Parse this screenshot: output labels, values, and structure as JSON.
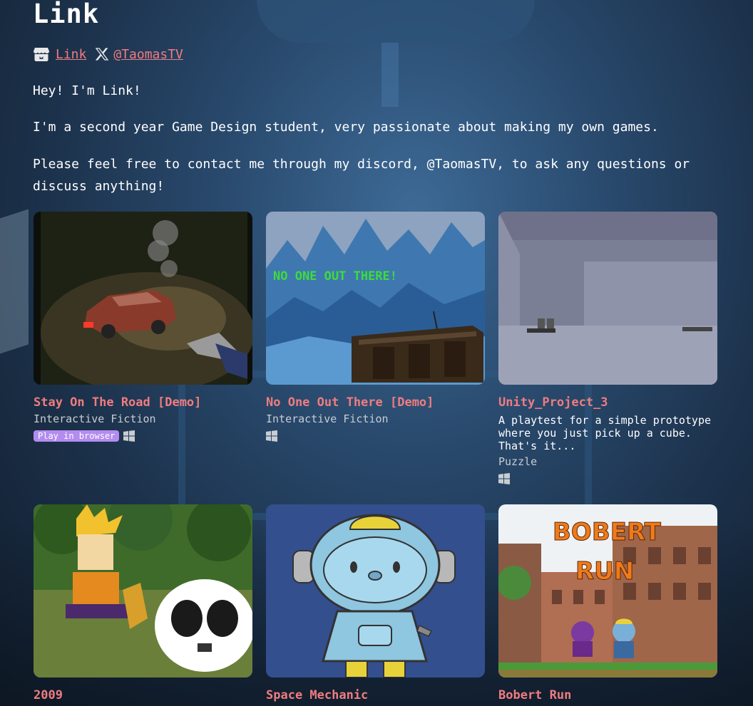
{
  "profile": {
    "name": "Link",
    "itch_icon": "itch-io-icon",
    "itch_link": "Link",
    "x_icon": "x-twitter-icon",
    "x_link": "@TaomasTV"
  },
  "bio": [
    "Hey! I'm Link!",
    "I'm a second year Game Design student, very passionate about making my own games.",
    "Please feel free to contact me through my discord, @TaomasTV, to ask any questions or discuss anything!"
  ],
  "games": [
    {
      "title": "Stay On The Road [Demo]",
      "genre": "Interactive Fiction",
      "description": "",
      "badge": "Play in browser",
      "platform_icon": "windows-icon"
    },
    {
      "title": "No One Out There [Demo]",
      "genre": "Interactive Fiction",
      "description": "",
      "badge": "",
      "platform_icon": "windows-icon",
      "thumb_text": "NO ONE OUT THERE!"
    },
    {
      "title": "Unity_Project_3",
      "genre": "Puzzle",
      "description": "A playtest for a simple prototype where you just pick up a cube. That's it...",
      "badge": "",
      "platform_icon": "windows-icon"
    },
    {
      "title": "2009",
      "genre": "",
      "description": "",
      "badge": "",
      "platform_icon": ""
    },
    {
      "title": "Space Mechanic",
      "genre": "",
      "description": "",
      "badge": "",
      "platform_icon": ""
    },
    {
      "title": "Bobert Run",
      "genre": "",
      "description": "",
      "badge": "",
      "platform_icon": "",
      "thumb_text_1": "BOBERT",
      "thumb_text_2": "RUN"
    }
  ],
  "colors": {
    "link": "#f07c80",
    "badge": "#b38cf0",
    "genre": "#c8cdd2"
  }
}
